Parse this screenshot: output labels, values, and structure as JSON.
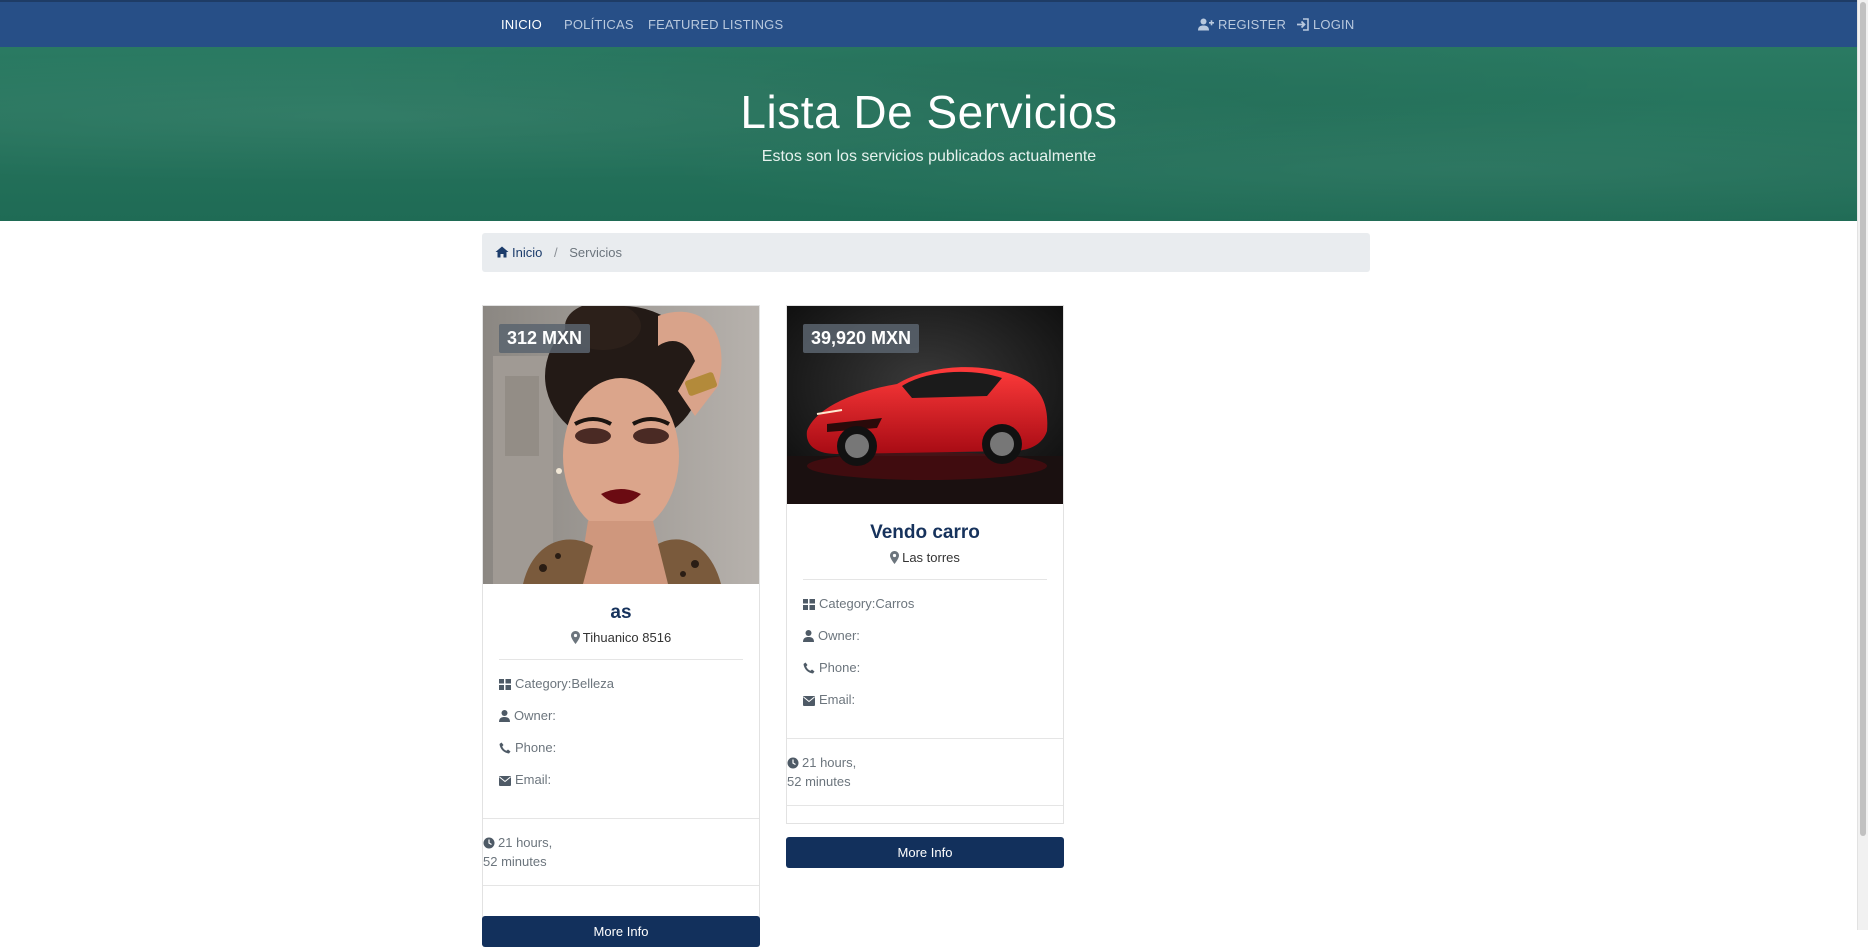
{
  "nav": {
    "left": [
      "INICIO",
      "POLÍTICAS",
      "FEATURED LISTINGS"
    ],
    "register": "REGISTER",
    "login": "LOGIN"
  },
  "hero": {
    "title": "Lista De Servicios",
    "subtitle": "Estos son los servicios publicados actualmente"
  },
  "breadcrumb": {
    "home": "Inicio",
    "separator": "/",
    "current": "Servicios"
  },
  "listings": [
    {
      "price": "312 MXN",
      "title": "as",
      "location": "Tihuanico 8516",
      "category": "Category:Belleza",
      "owner": "Owner:",
      "phone": "Phone:",
      "email": "Email:",
      "time_line1": "21 hours,",
      "time_line2": "52 minutes",
      "button": "More Info",
      "image": "woman portrait with makeup"
    },
    {
      "price": "39,920 MXN",
      "title": "Vendo carro",
      "location": "Las torres",
      "category": "Category:Carros",
      "owner": "Owner:",
      "phone": "Phone:",
      "email": "Email:",
      "time_line1": "21 hours,",
      "time_line2": "52 minutes",
      "button": "More Info",
      "image": "red sports car"
    }
  ],
  "icons": {
    "register": "user-plus-icon",
    "login": "sign-in-icon",
    "home": "home-icon",
    "location": "map-marker-icon",
    "category": "grid-icon",
    "owner": "user-icon",
    "phone": "phone-icon",
    "email": "envelope-icon",
    "time": "clock-icon"
  },
  "colors": {
    "navbar": "#274f87",
    "hero": "#1f6b55",
    "button": "#12305c",
    "title": "#16325c"
  }
}
